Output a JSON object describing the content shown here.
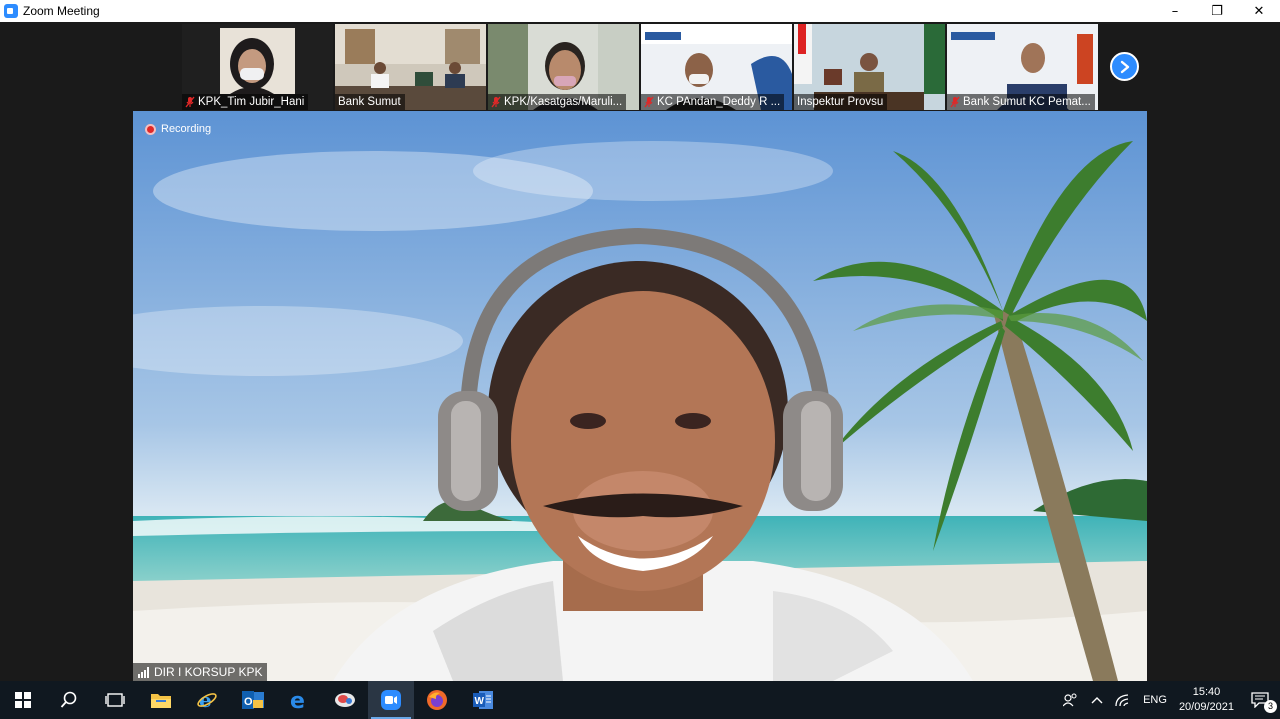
{
  "window": {
    "title": "Zoom Meeting",
    "controls": {
      "minimize": "–",
      "restore": "❐",
      "close": "✕"
    }
  },
  "thumbnails": [
    {
      "name": "KPK_Tim Jubir_Hani",
      "muted": true
    },
    {
      "name": "Bank Sumut",
      "muted": false
    },
    {
      "name": "KPK/Kasatgas/Maruli...",
      "muted": true
    },
    {
      "name": "KC PAndan_Deddy R ...",
      "muted": true
    },
    {
      "name": "Inspektur Provsu",
      "muted": false
    },
    {
      "name": "Bank Sumut KC Pemat...",
      "muted": true
    }
  ],
  "main": {
    "recording_label": "Recording",
    "speaker_name": "DIR I KORSUP KPK"
  },
  "taskbar": {
    "apps": [
      "start-icon",
      "search-icon",
      "task-view-icon",
      "file-explorer-icon",
      "internet-explorer-icon",
      "outlook-icon",
      "edge-icon",
      "snipping-icon",
      "zoom-icon",
      "firefox-icon",
      "word-icon"
    ],
    "active_app": "zoom-icon",
    "tray": {
      "language": "ENG",
      "time": "15:40",
      "date": "20/09/2021",
      "notification_count": "3"
    }
  },
  "colors": {
    "zoom_blue": "#2d8cff",
    "taskbar": "#101820",
    "recording_red": "#e02828",
    "mute_red": "#e02828"
  }
}
